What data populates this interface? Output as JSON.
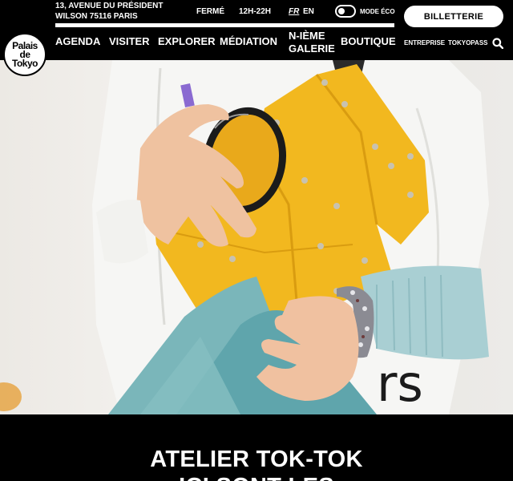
{
  "header": {
    "address_line1": "13, avenue du président",
    "address_line2": "Wilson 75116 Paris",
    "status": "FERMÉ",
    "hours": "12H-22H",
    "languages": [
      "FR",
      "EN"
    ],
    "active_language": "FR",
    "eco_mode_label": "MODE ÉCO",
    "eco_mode_on": false,
    "ticket_label": "BILLETTERIE",
    "logo_text": [
      "Palais",
      "de",
      "Tokyo"
    ]
  },
  "nav": {
    "items": [
      "AGENDA",
      "VISITER",
      "EXPLORER",
      "MÉDIATION",
      "N-IÈME",
      "GALERIE",
      "BOUTIQUE"
    ],
    "secondary": [
      "ENTREPRISE",
      "TOKYOPASS"
    ],
    "search_icon": "search-icon"
  },
  "hero": {
    "overlay_text": "rs"
  },
  "event": {
    "title": "ATELIER TOK-TOK",
    "subtitle": "ICI SONT LES"
  },
  "colors": {
    "background": "#000000",
    "text": "#ffffff",
    "accent_yellow": "#f2b81f",
    "accent_teal": "#6fb3b8",
    "cuff_blue": "#a9cfd3"
  }
}
